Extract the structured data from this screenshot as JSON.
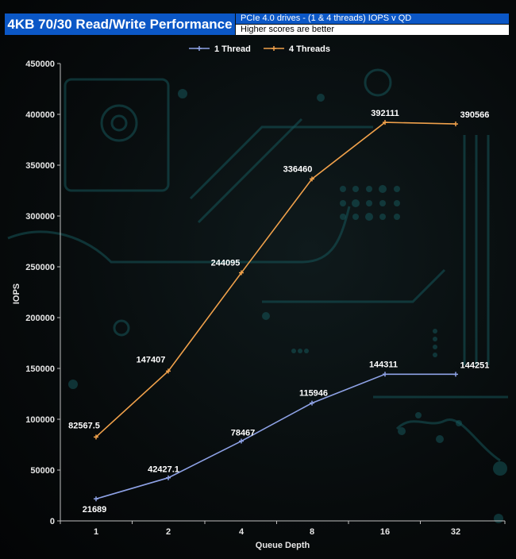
{
  "title": "4KB 70/30 Read/Write Performance",
  "subtitle_1": "PCIe 4.0 drives - (1 & 4 threads) IOPS v QD",
  "subtitle_2": "Higher scores are better",
  "colors": {
    "series_1": "#8ea2e6",
    "series_2": "#f0a14b",
    "title_bg": "#0b57c6"
  },
  "chart_data": {
    "type": "line",
    "xlabel": "Queue Depth",
    "ylabel": "IOPS",
    "categories": [
      "1",
      "2",
      "4",
      "8",
      "16",
      "32"
    ],
    "ylim": [
      0,
      450000
    ],
    "yticks": [
      "0",
      "50000",
      "100000",
      "150000",
      "200000",
      "250000",
      "300000",
      "350000",
      "400000",
      "450000"
    ],
    "legend_position": "top",
    "grid": false,
    "series": [
      {
        "name": "1 Thread",
        "values": [
          21689,
          42427.1,
          78467,
          115946,
          144311,
          144251
        ],
        "labels": [
          "21689",
          "42427.1",
          "78467",
          "115946",
          "144311",
          "144251"
        ]
      },
      {
        "name": "4 Threads",
        "values": [
          82567.5,
          147407,
          244095,
          336460,
          392111,
          390566
        ],
        "labels": [
          "82567.5",
          "147407",
          "244095",
          "336460",
          "392111",
          "390566"
        ]
      }
    ]
  }
}
